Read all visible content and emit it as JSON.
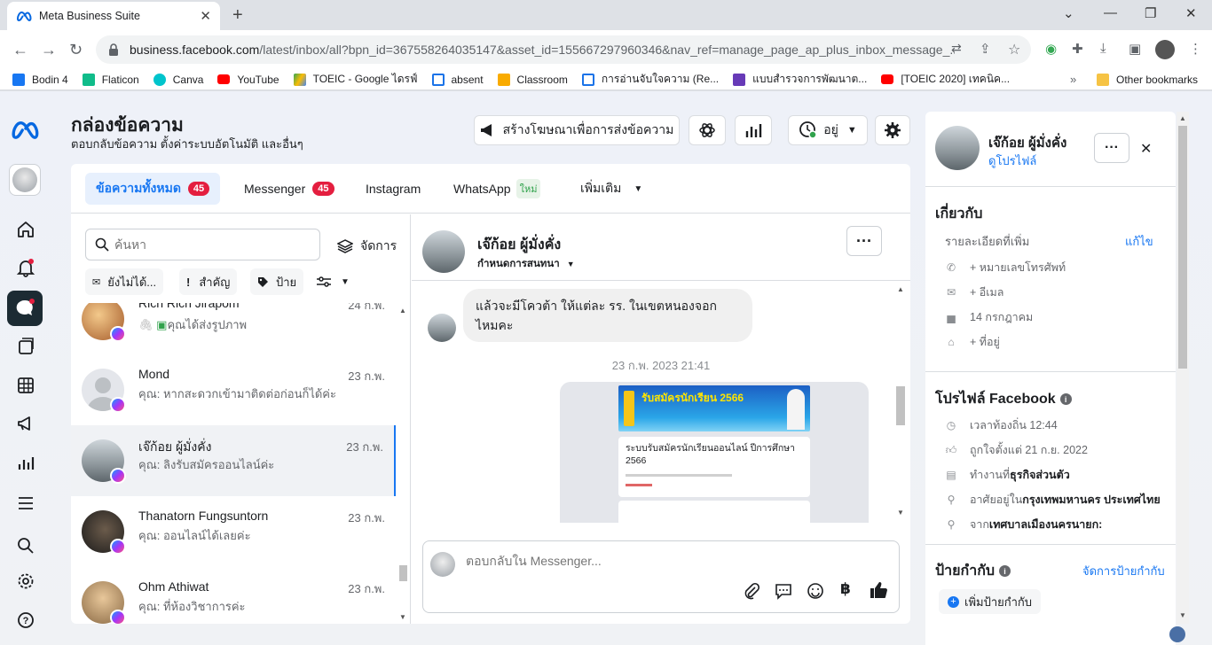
{
  "browser": {
    "tab_title": "Meta Business Suite",
    "url_host": "business.facebook.com",
    "url_path": "/latest/inbox/all?bpn_id=367558264035147&asset_id=155667297960346&nav_ref=manage_page_ap_plus_inbox_message_...",
    "bookmarks": [
      {
        "label": "Bodin 4",
        "color": "#1877f2"
      },
      {
        "label": "Flaticon",
        "color": "#10bc8a"
      },
      {
        "label": "Canva",
        "color": "#00c4cc"
      },
      {
        "label": "YouTube",
        "color": "#ff0000"
      },
      {
        "label": "TOEIC - Google ไดรฟ์",
        "color": "#fbbc04"
      },
      {
        "label": "absent",
        "color": "#1a73e8"
      },
      {
        "label": "Classroom",
        "color": "#f9ab00"
      },
      {
        "label": "การอ่านจับใจความ (Re...",
        "color": "#1a73e8"
      },
      {
        "label": "แบบสำรวจการพัฒนาต...",
        "color": "#673ab7"
      },
      {
        "label": "[TOEIC 2020] เทคนิค...",
        "color": "#ff0000"
      }
    ],
    "other_bookmarks": "Other bookmarks"
  },
  "header": {
    "title": "กล่องข้อความ",
    "subtitle": "ตอบกลับข้อความ ตั้งค่าระบบอัตโนมัติ และอื่นๆ",
    "create_ad_label": "สร้างโฆษณาเพื่อการส่งข้อความ",
    "status_label": "อยู่"
  },
  "tabs": [
    {
      "label": "ข้อความทั้งหมด",
      "count": "45"
    },
    {
      "label": "Messenger",
      "count": "45"
    },
    {
      "label": "Instagram"
    },
    {
      "label": "WhatsApp",
      "new": "ใหม่"
    },
    {
      "label": "เพิ่มเติม"
    }
  ],
  "list": {
    "search_placeholder": "ค้นหา",
    "manage_label": "จัดการ",
    "filters": [
      "ยังไม่ได้...",
      "สำคัญ",
      "ป้าย"
    ],
    "conversations": [
      {
        "name": "Rich Rich Jirapom",
        "preview": "คุณได้ส่งรูปภาพ",
        "date": "24 ก.พ."
      },
      {
        "name": "Mond",
        "preview": "คุณ: หากสะดวกเข้ามาติดต่อก่อนก็ได้ค่ะ",
        "date": "23 ก.พ."
      },
      {
        "name": "เจ๊ก้อย ผู้มั่งคั่ง",
        "preview": "คุณ: ลิงรับสมัครออนไลน์ค่ะ",
        "date": "23 ก.พ."
      },
      {
        "name": "Thanatorn Fungsuntorn",
        "preview": "คุณ: ออนไลน์ได้เลยค่ะ",
        "date": "23 ก.พ."
      },
      {
        "name": "Ohm Athiwat",
        "preview": "คุณ: ที่ห้องวิชาการค่ะ",
        "date": "23 ก.พ."
      }
    ]
  },
  "chat": {
    "contact_name": "เจ๊ก้อย ผู้มั่งคั่ง",
    "assign_label": "กำหนดการสนทนา",
    "message_1": "แล้วจะมีโควต้า ให้แต่ละ รร. ในเขตหนองจอก ไหมคะ",
    "timestamp": "23 ก.พ. 2023 21:41",
    "card_banner": "รับสมัครนักเรียน 2566",
    "card_title": "ระบบรับสมัครนักเรียนออนไลน์ ปีการศึกษา 2566",
    "composer_placeholder": "ตอบกลับใน Messenger..."
  },
  "profile": {
    "name": "เจ๊ก้อย ผู้มั่งคั่ง",
    "view_profile": "ดูโปรไฟล์",
    "about_title": "เกี่ยวกับ",
    "more_details": "รายละเอียดที่เพิ่ม",
    "edit": "แก้ไข",
    "phone": "+ หมายเลขโทรศัพท์",
    "email": "+ อีเมล",
    "birthday": "14 กรกฎาคม",
    "address": "+ ที่อยู่",
    "fb_title": "โปรไฟล์ Facebook",
    "local_time": "เวลาท้องถิ่น 12:44",
    "followed_since": "ถูกใจตั้งแต่ 21 ก.ย. 2022",
    "work_prefix": "ทำงานที่ ",
    "work": "ธุรกิจส่วนตัว",
    "lives_prefix": "อาศัยอยู่ใน ",
    "lives": "กรุงเทพมหานคร ประเทศไทย",
    "from_prefix": "จาก ",
    "from": "เทศบาลเมืองนครนายก:",
    "labels_title": "ป้ายกำกับ",
    "manage_labels": "จัดการป้ายกำกับ",
    "add_label": "เพิ่มป้ายกำกับ"
  }
}
